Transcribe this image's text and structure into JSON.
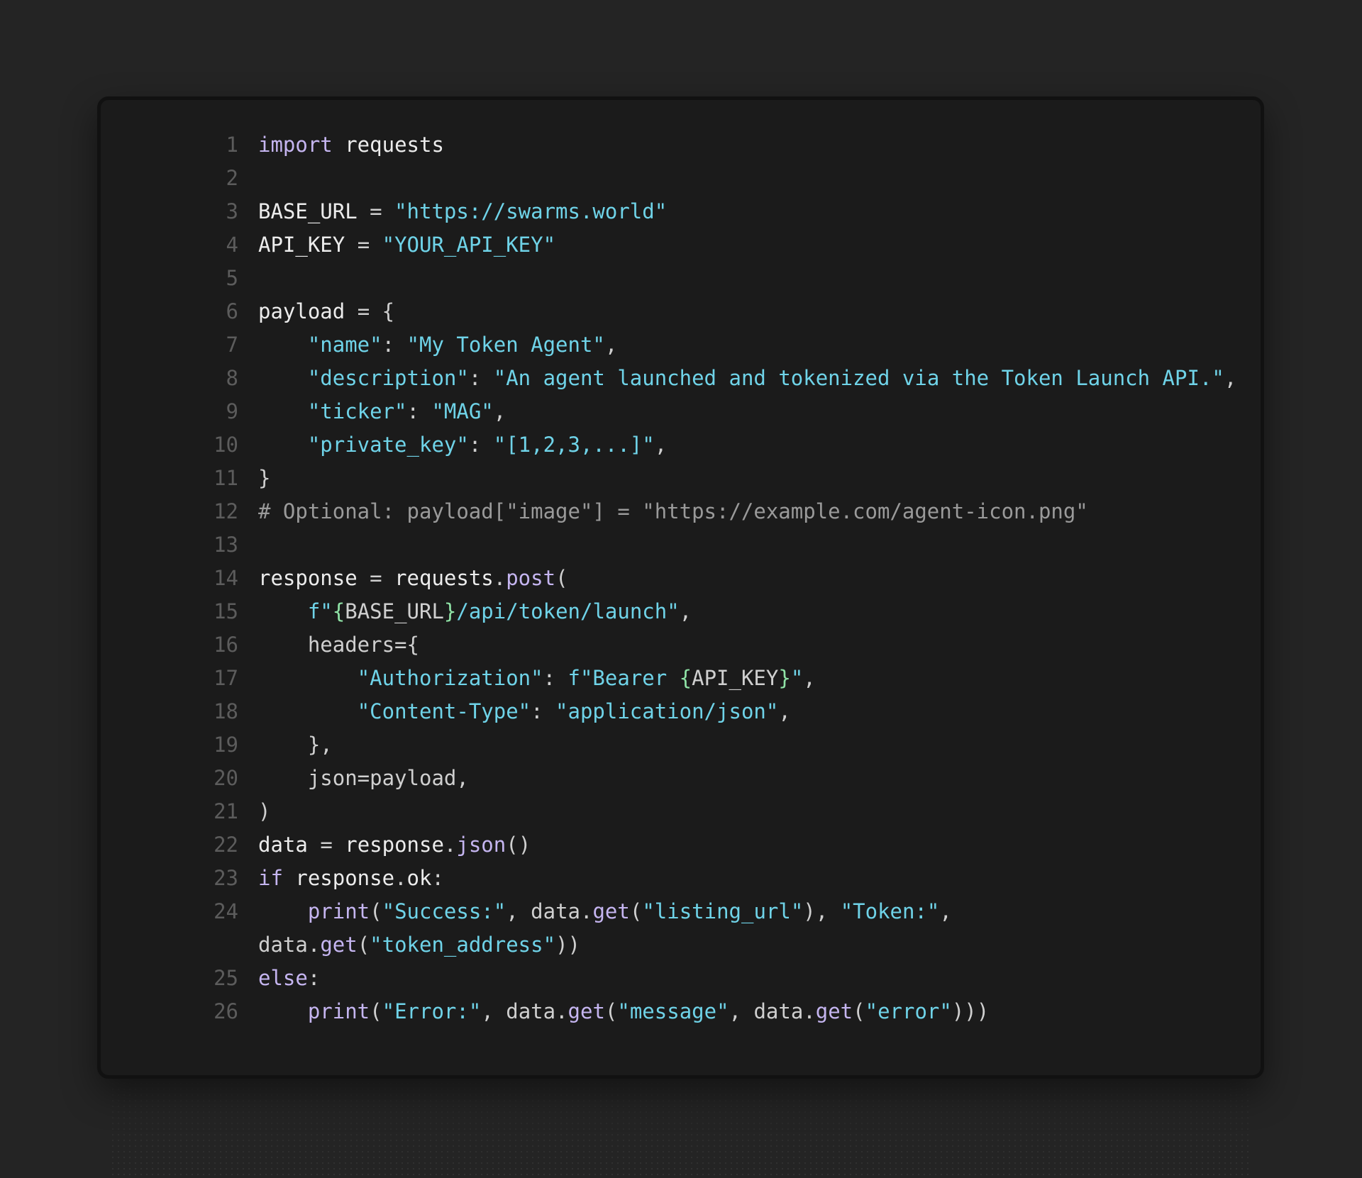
{
  "editor": {
    "language": "python",
    "lines": [
      [
        {
          "t": "k",
          "v": "import"
        },
        {
          "t": "n",
          "v": " requests"
        }
      ],
      [],
      [
        {
          "t": "n",
          "v": "BASE_URL "
        },
        {
          "t": "p",
          "v": "= "
        },
        {
          "t": "s",
          "v": "\"https://swarms.world\""
        }
      ],
      [
        {
          "t": "n",
          "v": "API_KEY "
        },
        {
          "t": "p",
          "v": "= "
        },
        {
          "t": "s",
          "v": "\"YOUR_API_KEY\""
        }
      ],
      [],
      [
        {
          "t": "n",
          "v": "payload "
        },
        {
          "t": "p",
          "v": "= {"
        }
      ],
      [
        {
          "t": "n",
          "v": "    "
        },
        {
          "t": "s",
          "v": "\"name\""
        },
        {
          "t": "p",
          "v": ": "
        },
        {
          "t": "s",
          "v": "\"My Token Agent\""
        },
        {
          "t": "p",
          "v": ","
        }
      ],
      [
        {
          "t": "n",
          "v": "    "
        },
        {
          "t": "s",
          "v": "\"description\""
        },
        {
          "t": "p",
          "v": ": "
        },
        {
          "t": "s",
          "v": "\"An agent launched and tokenized via the Token Launch API.\""
        },
        {
          "t": "p",
          "v": ","
        }
      ],
      [
        {
          "t": "n",
          "v": "    "
        },
        {
          "t": "s",
          "v": "\"ticker\""
        },
        {
          "t": "p",
          "v": ": "
        },
        {
          "t": "s",
          "v": "\"MAG\""
        },
        {
          "t": "p",
          "v": ","
        }
      ],
      [
        {
          "t": "n",
          "v": "    "
        },
        {
          "t": "s",
          "v": "\"private_key\""
        },
        {
          "t": "p",
          "v": ": "
        },
        {
          "t": "s",
          "v": "\"[1,2,3,...]\""
        },
        {
          "t": "p",
          "v": ","
        }
      ],
      [
        {
          "t": "p",
          "v": "}"
        }
      ],
      [
        {
          "t": "c",
          "v": "# Optional: payload[\"image\"] = \"https://example.com/agent-icon.png\""
        }
      ],
      [],
      [
        {
          "t": "n",
          "v": "response "
        },
        {
          "t": "p",
          "v": "= "
        },
        {
          "t": "n",
          "v": "requests"
        },
        {
          "t": "p",
          "v": "."
        },
        {
          "t": "k",
          "v": "post"
        },
        {
          "t": "p",
          "v": "("
        }
      ],
      [
        {
          "t": "n",
          "v": "    "
        },
        {
          "t": "s",
          "v": "f\""
        },
        {
          "t": "b",
          "v": "{"
        },
        {
          "t": "p",
          "v": "BASE_URL"
        },
        {
          "t": "b",
          "v": "}"
        },
        {
          "t": "s",
          "v": "/api/token/launch\""
        },
        {
          "t": "p",
          "v": ","
        }
      ],
      [
        {
          "t": "n",
          "v": "    "
        },
        {
          "t": "p",
          "v": "headers={"
        }
      ],
      [
        {
          "t": "n",
          "v": "        "
        },
        {
          "t": "s",
          "v": "\"Authorization\""
        },
        {
          "t": "p",
          "v": ": "
        },
        {
          "t": "s",
          "v": "f\"Bearer "
        },
        {
          "t": "b",
          "v": "{"
        },
        {
          "t": "p",
          "v": "API_KEY"
        },
        {
          "t": "b",
          "v": "}"
        },
        {
          "t": "s",
          "v": "\""
        },
        {
          "t": "p",
          "v": ","
        }
      ],
      [
        {
          "t": "n",
          "v": "        "
        },
        {
          "t": "s",
          "v": "\"Content-Type\""
        },
        {
          "t": "p",
          "v": ": "
        },
        {
          "t": "s",
          "v": "\"application/json\""
        },
        {
          "t": "p",
          "v": ","
        }
      ],
      [
        {
          "t": "n",
          "v": "    "
        },
        {
          "t": "p",
          "v": "},"
        }
      ],
      [
        {
          "t": "n",
          "v": "    "
        },
        {
          "t": "p",
          "v": "json=payload,"
        }
      ],
      [
        {
          "t": "p",
          "v": ")"
        }
      ],
      [
        {
          "t": "n",
          "v": "data "
        },
        {
          "t": "p",
          "v": "= "
        },
        {
          "t": "n",
          "v": "response"
        },
        {
          "t": "p",
          "v": "."
        },
        {
          "t": "k",
          "v": "json"
        },
        {
          "t": "p",
          "v": "()"
        }
      ],
      [
        {
          "t": "k",
          "v": "if"
        },
        {
          "t": "n",
          "v": " response"
        },
        {
          "t": "p",
          "v": "."
        },
        {
          "t": "n",
          "v": "ok"
        },
        {
          "t": "p",
          "v": ":"
        }
      ],
      [
        {
          "t": "n",
          "v": "    "
        },
        {
          "t": "k",
          "v": "print"
        },
        {
          "t": "p",
          "v": "("
        },
        {
          "t": "s",
          "v": "\"Success:\""
        },
        {
          "t": "p",
          "v": ", data."
        },
        {
          "t": "k",
          "v": "get"
        },
        {
          "t": "p",
          "v": "("
        },
        {
          "t": "s",
          "v": "\"listing_url\""
        },
        {
          "t": "p",
          "v": "), "
        },
        {
          "t": "s",
          "v": "\"Token:\""
        },
        {
          "t": "p",
          "v": ", data."
        },
        {
          "t": "k",
          "v": "get"
        },
        {
          "t": "p",
          "v": "("
        },
        {
          "t": "s",
          "v": "\"token_address\""
        },
        {
          "t": "p",
          "v": "))"
        }
      ],
      [
        {
          "t": "k",
          "v": "else"
        },
        {
          "t": "p",
          "v": ":"
        }
      ],
      [
        {
          "t": "n",
          "v": "    "
        },
        {
          "t": "k",
          "v": "print"
        },
        {
          "t": "p",
          "v": "("
        },
        {
          "t": "s",
          "v": "\"Error:\""
        },
        {
          "t": "p",
          "v": ", data."
        },
        {
          "t": "k",
          "v": "get"
        },
        {
          "t": "p",
          "v": "("
        },
        {
          "t": "s",
          "v": "\"message\""
        },
        {
          "t": "p",
          "v": ", data."
        },
        {
          "t": "k",
          "v": "get"
        },
        {
          "t": "p",
          "v": "("
        },
        {
          "t": "s",
          "v": "\"error\""
        },
        {
          "t": "p",
          "v": ")))"
        }
      ]
    ]
  },
  "theme": {
    "background": "#242424",
    "card": "#1b1b1b",
    "keyword": "#c5b5f0",
    "string": "#6fd3e8",
    "comment": "#9a9a9a",
    "line_number": "#5c5c5c"
  }
}
